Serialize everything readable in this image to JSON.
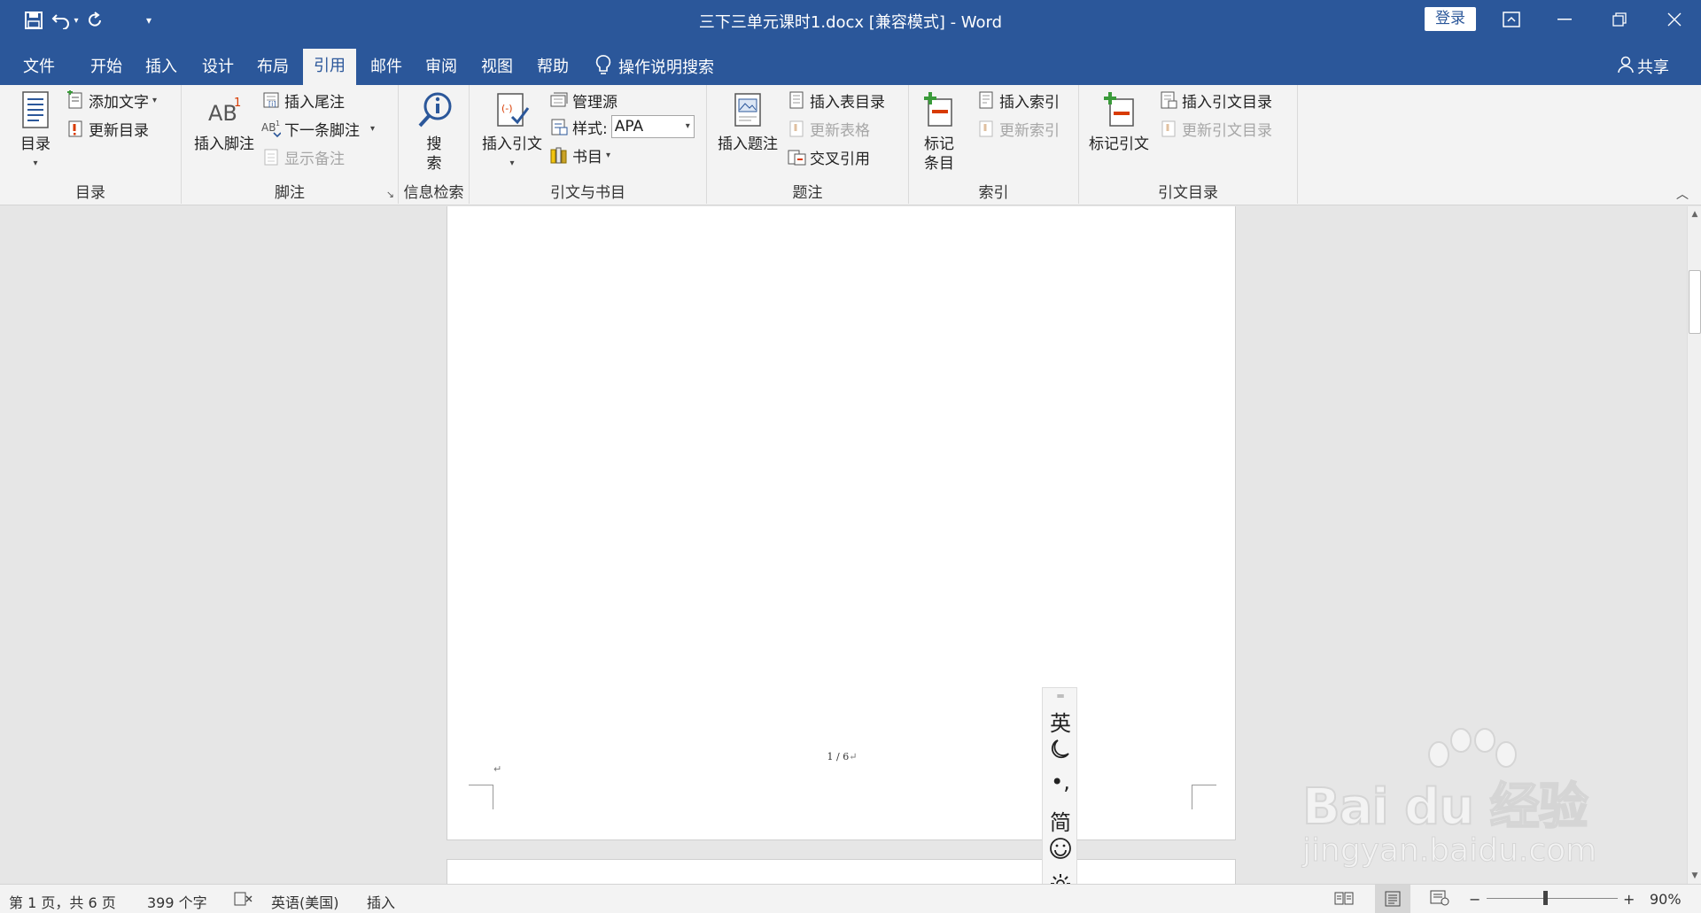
{
  "app": {
    "title": "三下三单元课时1.docx [兼容模式]  -  Word",
    "login": "登录",
    "share": "共享",
    "tell_me": "操作说明搜索"
  },
  "tabs": [
    "文件",
    "开始",
    "插入",
    "设计",
    "布局",
    "引用",
    "邮件",
    "审阅",
    "视图",
    "帮助"
  ],
  "active_tab": "引用",
  "ribbon": {
    "toc": {
      "group": "目录",
      "big": "目录",
      "add_text": "添加文字",
      "update": "更新目录"
    },
    "footnotes": {
      "group": "脚注",
      "insert_footnote": "插入脚注",
      "insert_endnote": "插入尾注",
      "next_footnote": "下一条脚注",
      "show_notes": "显示备注"
    },
    "research": {
      "group": "信息检索",
      "search_line1": "搜",
      "search_line2": "索"
    },
    "citations": {
      "group": "引文与书目",
      "insert_citation": "插入引文",
      "manage_sources": "管理源",
      "style_label": "样式:",
      "style_value": "APA",
      "bibliography": "书目"
    },
    "captions": {
      "group": "题注",
      "insert_caption": "插入题注",
      "insert_table_of_figures": "插入表目录",
      "update_table": "更新表格",
      "cross_reference": "交叉引用"
    },
    "index": {
      "group": "索引",
      "mark_entry_line1": "标记",
      "mark_entry_line2": "条目",
      "insert_index": "插入索引",
      "update_index": "更新索引"
    },
    "table_of_authorities": {
      "group": "引文目录",
      "mark_citation": "标记引文",
      "insert_toa": "插入引文目录",
      "update_toa": "更新引文目录"
    }
  },
  "document": {
    "page_number": "1 / 6"
  },
  "ime": {
    "mode": "英",
    "punct": "•,",
    "charset": "简"
  },
  "status": {
    "page": "第 1 页，共 6 页",
    "words": "399 个字",
    "language": "英语(美国)",
    "insert_mode": "插入",
    "zoom": "90%",
    "zoom_level": 0.9
  },
  "watermark": {
    "main": "Bai du 经验",
    "sub": "jingyan.baidu.com"
  },
  "colors": {
    "brand": "#2b579a",
    "ribbon_bg": "#f3f3f3",
    "canvas_bg": "#e6e6e6"
  }
}
